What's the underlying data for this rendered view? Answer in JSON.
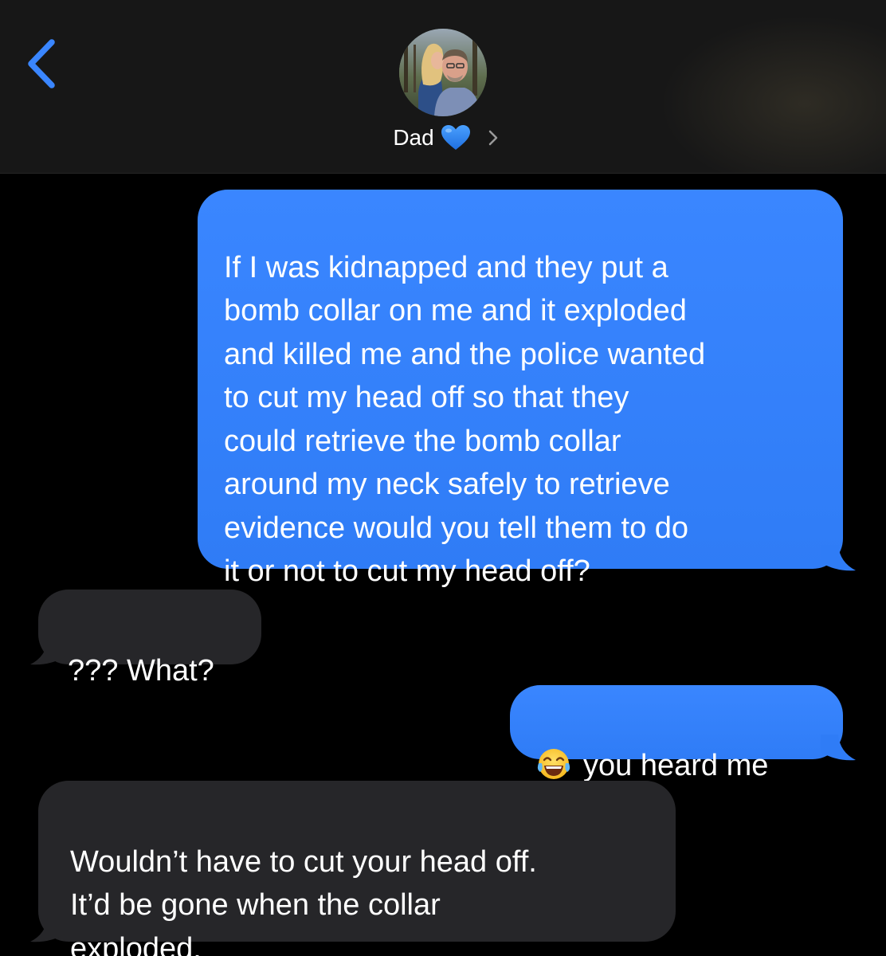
{
  "header": {
    "contact_name": "Dad",
    "contact_heart": "💙",
    "back_icon": "chevron-left-icon",
    "details_icon": "chevron-right-icon",
    "accent_color": "#3a86ff"
  },
  "messages": [
    {
      "direction": "sent",
      "text": "If I was kidnapped and they put a\nbomb collar on me and it exploded\nand killed me and the police wanted\nto cut my head off so that they\ncould retrieve the bomb collar\naround my neck safely to retrieve\nevidence would you tell them to do\nit or not to cut my head off?"
    },
    {
      "direction": "received",
      "text": "??? What?"
    },
    {
      "direction": "sent",
      "emoji": "😂",
      "text": "you heard me"
    },
    {
      "direction": "received",
      "text": "Wouldn’t have to cut your head off.\nIt’d be gone when the collar\nexploded."
    }
  ],
  "colors": {
    "sent_bubble": "#3a86ff",
    "received_bubble": "#262629",
    "background": "#000000",
    "header_background": "#171717"
  }
}
